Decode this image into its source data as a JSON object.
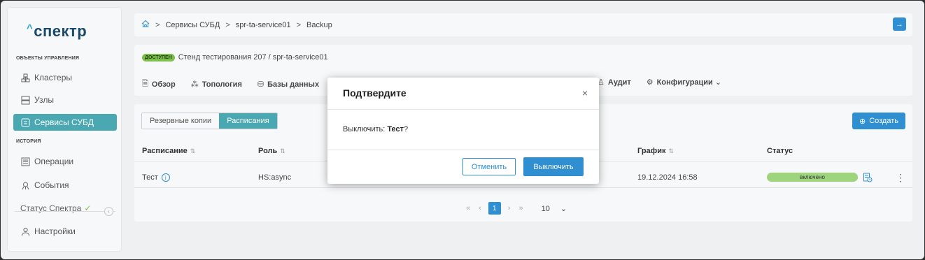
{
  "sidebar": {
    "logo": "спектр",
    "section_objects": "ОБЪЕКТЫ УПРАВЛЕНИЯ",
    "section_history": "ИСТОРИЯ",
    "items": [
      {
        "label": "Кластеры",
        "icon": "cluster-icon"
      },
      {
        "label": "Узлы",
        "icon": "server-icon"
      },
      {
        "label": "Сервисы СУБД",
        "icon": "dbms-icon"
      },
      {
        "label": "Операции",
        "icon": "operations-icon"
      },
      {
        "label": "События",
        "icon": "events-icon"
      },
      {
        "label": "Настройки",
        "icon": "user-icon"
      }
    ],
    "status_label": "Статус Спектра"
  },
  "breadcrumb": {
    "items": [
      "Сервисы СУБД",
      "spr-ta-service01",
      "Backup"
    ]
  },
  "service": {
    "badge": "ДОСТУПЕН",
    "path": "Стенд тестирования 207 / spr-ta-service01"
  },
  "tabs": {
    "left": [
      "Обзор",
      "Топология",
      "Базы данных"
    ],
    "right": [
      "Аудит",
      "Конфигурации"
    ]
  },
  "content": {
    "segments": [
      "Резервные копии",
      "Расписания"
    ],
    "create_label": "Создать",
    "columns": [
      "Расписание",
      "Роль",
      "График",
      "Статус"
    ],
    "row": {
      "name": "Тест",
      "role": "HS:async",
      "schedule": "19.12.2024 16:58",
      "status": "включено"
    },
    "pager": {
      "first": "«",
      "prev": "‹",
      "current": "1",
      "next": "›",
      "last": "»",
      "page_size": "10"
    }
  },
  "modal": {
    "title": "Подтвердите",
    "close": "×",
    "text_prefix": "Выключить: ",
    "text_name": "Тест",
    "text_suffix": "?",
    "cancel": "Отменить",
    "confirm": "Выключить"
  },
  "colors": {
    "accent": "#2f8fd1",
    "teal": "#4aa8b2",
    "green": "#7cc04b"
  }
}
